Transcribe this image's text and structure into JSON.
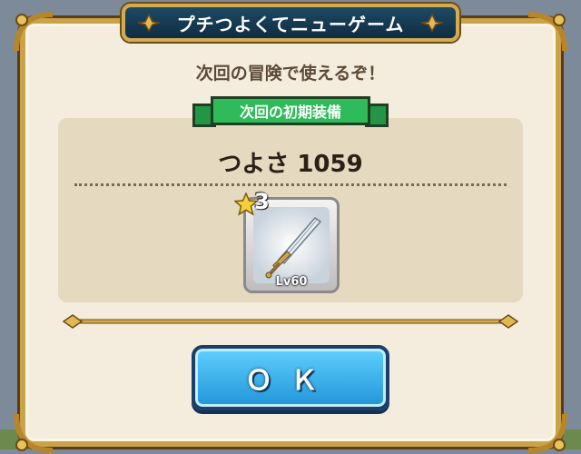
{
  "dialog": {
    "title": "プチつよくてニューゲーム",
    "subtitle": "次回の冒険で使えるぞ！",
    "banner_label": "次回の初期装備",
    "strength_text": "つよさ 1059"
  },
  "item": {
    "icon": "sword-icon",
    "star_rank": "3",
    "level_label": "Lv60"
  },
  "ok_button": {
    "label": "ＯＫ"
  },
  "colors": {
    "frame_gold": "#caa24a",
    "panel_bg": "#f4ecdc",
    "title_plate": "#1d4a66",
    "banner_green": "#2fbb5a",
    "button_blue": "#2194d8"
  }
}
